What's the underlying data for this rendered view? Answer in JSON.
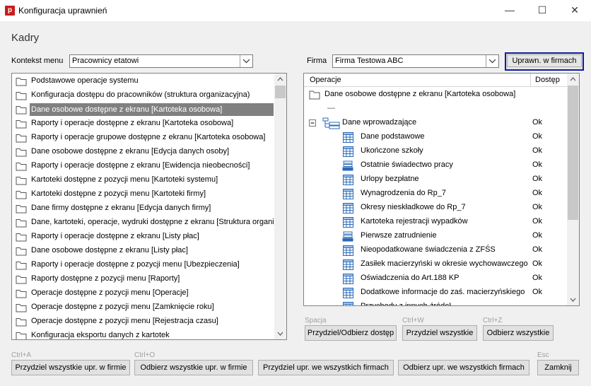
{
  "window": {
    "title": "Konfiguracja uprawnień",
    "app_icon_letter": "p"
  },
  "heading": "Kadry",
  "context": {
    "label": "Kontekst menu",
    "value": "Pracownicy etatowi"
  },
  "firm": {
    "label": "Firma",
    "value": "Firma Testowa ABC"
  },
  "buttons": {
    "upr_firms": "Uprawn. w firmach",
    "toggle": "Przydziel/Odbierz dostęp",
    "grant_all": "Przydziel wszystkie",
    "revoke_all": "Odbierz wszystkie",
    "grant_all_firm": "Przydziel wszystkie upr. w firmie",
    "revoke_all_firm": "Odbierz wszystkie upr. w firmie",
    "grant_all_firms": "Przydziel upr. we wszystkich firmach",
    "revoke_all_firms": "Odbierz upr. we wszystkich firmach",
    "close": "Zamknij"
  },
  "shortcuts": {
    "toggle": "Spacja",
    "grant_all": "Ctrl+W",
    "revoke_all": "Ctrl+Z",
    "grant_all_firm": "Ctrl+A",
    "revoke_all_firm": "Ctrl+O",
    "close": "Esc"
  },
  "menu_list": [
    "Podstawowe operacje systemu",
    "Konfiguracja dostępu do pracowników (struktura organizacyjna)",
    "Dane osobowe dostępne z ekranu [Kartoteka osobowa]",
    "Raporty i operacje dostępne z ekranu [Kartoteka osobowa]",
    "Raporty i operacje grupowe dostępne z ekranu [Kartoteka osobowa]",
    "Dane osobowe dostępne z ekranu [Edycja danych osoby]",
    "Raporty i operacje dostępne z ekranu [Ewidencja nieobecności]",
    "Kartoteki dostępne z pozycji menu [Kartoteki systemu]",
    "Kartoteki dostępne z pozycji menu [Kartoteki firmy]",
    "Dane firmy dostępne z ekranu [Edycja danych firmy]",
    "Dane, kartoteki, operacje, wydruki dostępne z ekranu [Struktura organizacyjna]",
    "Raporty i operacje dostępne z ekranu [Listy płac]",
    "Dane osobowe dostępne z ekranu [Listy płac]",
    "Raporty i operacje dostępne z pozycji menu [Ubezpieczenia]",
    "Raporty dostępne z pozycji menu [Raporty]",
    "Operacje dostępne z pozycji menu [Operacje]",
    "Operacje dostępne z pozycji menu [Zamknięcie roku]",
    "Operacje dostępne z pozycji menu [Rejestracja czasu]",
    "Konfiguracja eksportu danych z kartotek"
  ],
  "selected_index": 2,
  "tree": {
    "col_operation": "Operacje",
    "col_access": "Dostęp",
    "root": "Dane osobowe dostępne z ekranu [Kartoteka osobowa]",
    "root_dash": "—",
    "group": "Dane wprowadzające",
    "group_access": "Ok",
    "items": [
      {
        "label": "Dane podstawowe",
        "access": "Ok",
        "icon": "grid-icon"
      },
      {
        "label": "Ukończone szkoły",
        "access": "Ok",
        "icon": "grid-icon"
      },
      {
        "label": "Ostatnie świadectwo pracy",
        "access": "Ok",
        "icon": "form-icon"
      },
      {
        "label": "Urlopy bezpłatne",
        "access": "Ok",
        "icon": "grid-icon"
      },
      {
        "label": "Wynagrodzenia do Rp_7",
        "access": "Ok",
        "icon": "grid-icon"
      },
      {
        "label": "Okresy nieskładkowe do Rp_7",
        "access": "Ok",
        "icon": "grid-icon"
      },
      {
        "label": "Kartoteka rejestracji wypadków",
        "access": "Ok",
        "icon": "grid-icon"
      },
      {
        "label": "Pierwsze zatrudnienie",
        "access": "Ok",
        "icon": "form-icon"
      },
      {
        "label": "Nieopodatkowane świadczenia z ZFŚS",
        "access": "Ok",
        "icon": "grid-icon"
      },
      {
        "label": "Zasiłek macierzyński w okresie wychowawczego",
        "access": "Ok",
        "icon": "grid-icon"
      },
      {
        "label": "Oświadczenia do Art.188 KP",
        "access": "Ok",
        "icon": "grid-icon"
      },
      {
        "label": "Dodatkowe informacje do zaś. macierzyńskiego",
        "access": "Ok",
        "icon": "grid-icon"
      },
      {
        "label": "Przychody z innych źródeł",
        "access": "",
        "icon": "grid-icon"
      }
    ]
  }
}
